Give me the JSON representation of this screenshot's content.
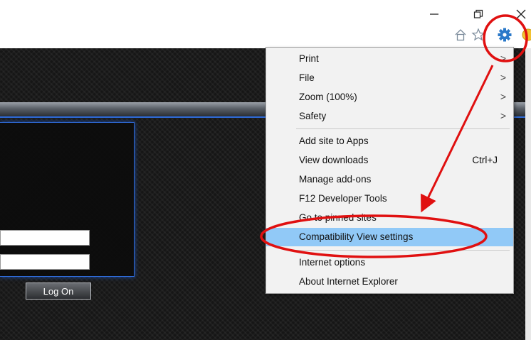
{
  "window": {
    "minimize_icon": "minimize-icon",
    "restore_icon": "restore-icon",
    "close_icon": "close-icon"
  },
  "toolbar": {
    "icons": [
      "home-icon",
      "star-icon",
      "gear-icon",
      "smiley-icon"
    ]
  },
  "menu": {
    "groups": [
      [
        {
          "label": "Print",
          "submenu": true
        },
        {
          "label": "File",
          "submenu": true
        },
        {
          "label": "Zoom (100%)",
          "submenu": true
        },
        {
          "label": "Safety",
          "submenu": true
        }
      ],
      [
        {
          "label": "Add site to Apps"
        },
        {
          "label": "View downloads",
          "shortcut": "Ctrl+J"
        },
        {
          "label": "Manage add-ons"
        },
        {
          "label": "F12 Developer Tools"
        },
        {
          "label": "Go to pinned sites"
        },
        {
          "label": "Compatibility View settings",
          "highlighted": true
        }
      ],
      [
        {
          "label": "Internet options"
        },
        {
          "label": "About Internet Explorer"
        }
      ]
    ],
    "arrow_glyph": ">"
  },
  "page": {
    "login_button": "Log On"
  },
  "colors": {
    "highlight": "#91c9f7",
    "annotation_red": "#e01010",
    "accent_blue": "#2f6bd8"
  }
}
